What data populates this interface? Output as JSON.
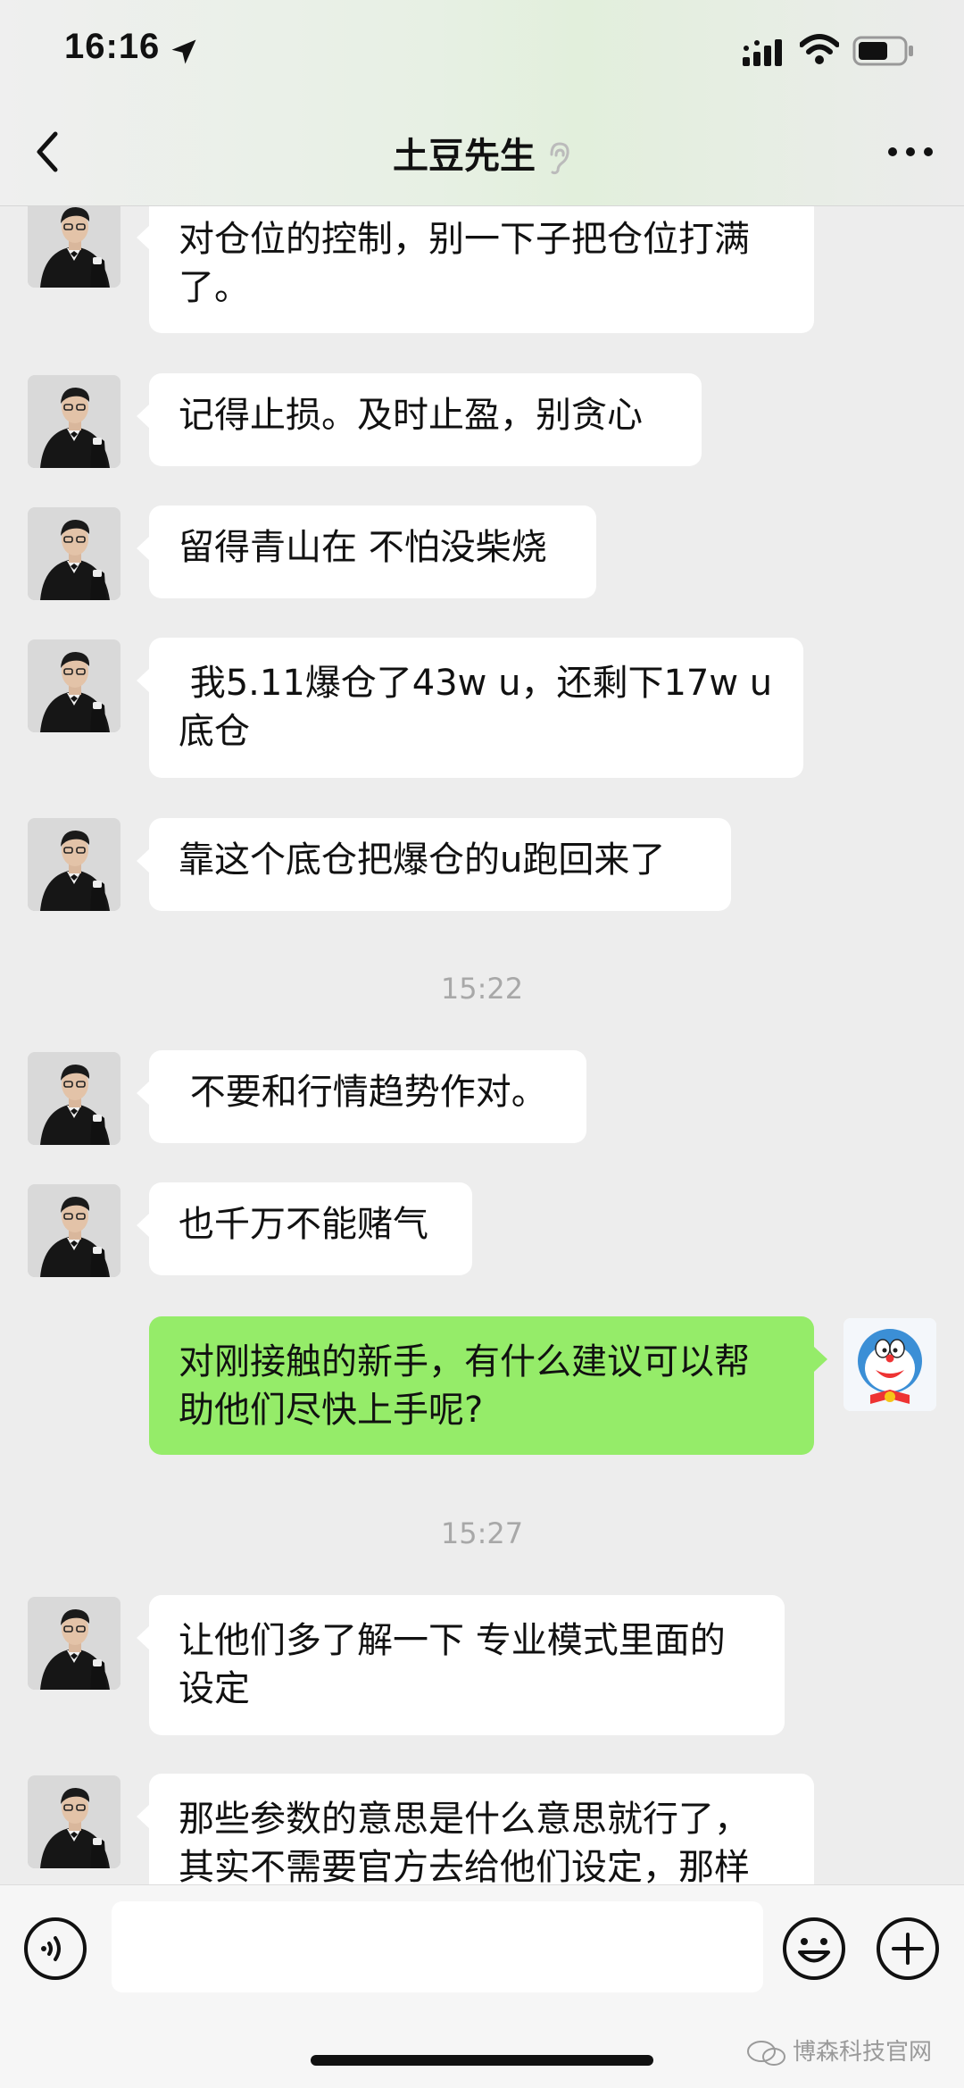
{
  "status_bar": {
    "time": "16:16"
  },
  "header": {
    "title": "土豆先生"
  },
  "messages": [
    {
      "text": "对仓位的控制，别一下子把仓位打满\n了。"
    },
    {
      "text": "记得止损。及时止盈，别贪心"
    },
    {
      "text": "留得青山在 不怕没柴烧"
    },
    {
      "text": " 我5.11爆仓了43w u，还剩下17w u\n底仓"
    },
    {
      "text": "靠这个底仓把爆仓的u跑回来了"
    },
    {
      "time": "15:22"
    },
    {
      "text": " 不要和行情趋势作对。"
    },
    {
      "text": "也千万不能赌气"
    },
    {
      "text": "对刚接触的新手，有什么建议可以帮\n助他们尽快上手呢?"
    },
    {
      "time": "15:27"
    },
    {
      "text": "让他们多了解一下 专业模式里面的\n设定"
    },
    {
      "text": "那些参数的意思是什么意思就行了，\n其实不需要官方去给他们设定，那样"
    }
  ],
  "input_bar": {
    "placeholder": ""
  },
  "watermark": {
    "text": "博森科技官网"
  },
  "colors": {
    "my_bubble": "#95ec69",
    "their_bubble": "#ffffff",
    "background": "#ededed"
  }
}
